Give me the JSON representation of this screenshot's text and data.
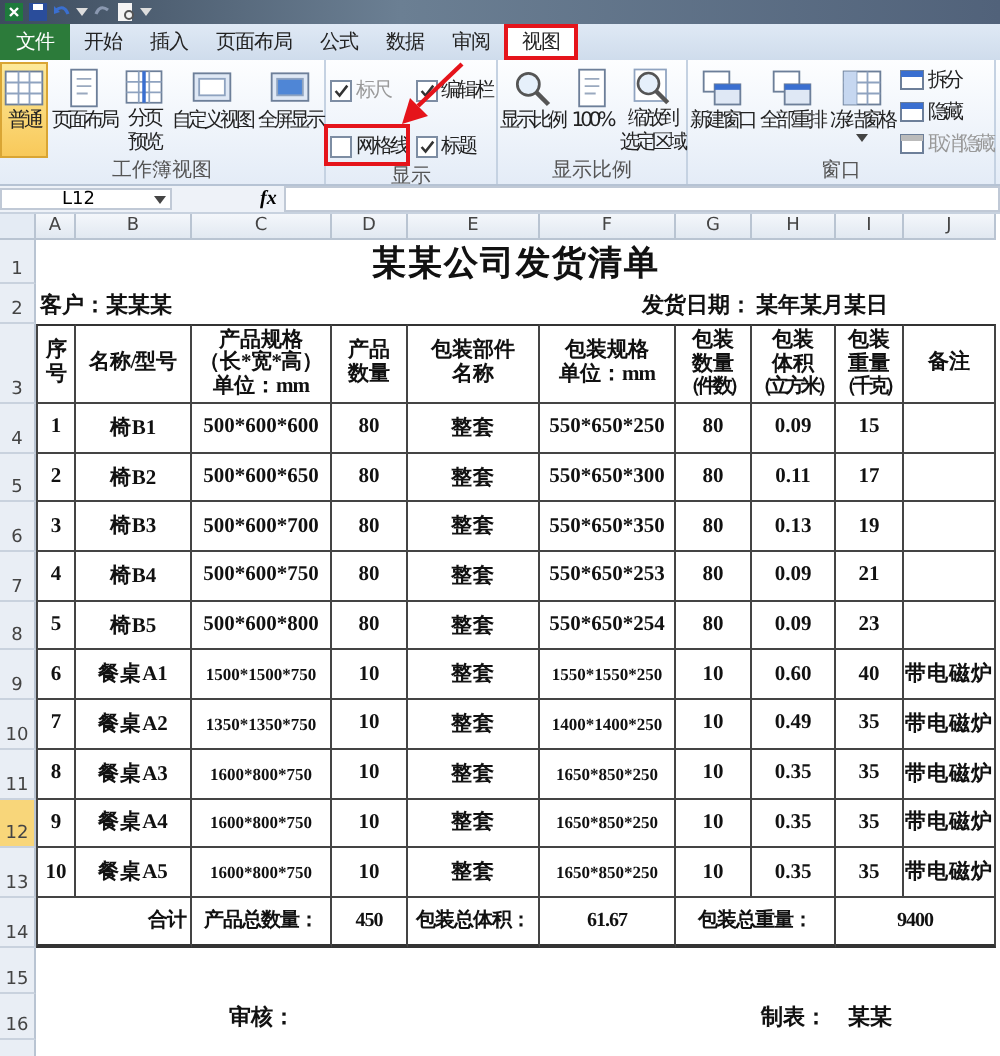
{
  "tabs": [
    {
      "label": "文件",
      "kind": "file",
      "selected": false,
      "highlighted": false
    },
    {
      "label": "开始",
      "kind": "tab",
      "selected": false,
      "highlighted": false
    },
    {
      "label": "插入",
      "kind": "tab",
      "selected": false,
      "highlighted": false
    },
    {
      "label": "页面布局",
      "kind": "tab",
      "selected": false,
      "highlighted": false
    },
    {
      "label": "公式",
      "kind": "tab",
      "selected": false,
      "highlighted": false
    },
    {
      "label": "数据",
      "kind": "tab",
      "selected": false,
      "highlighted": false
    },
    {
      "label": "审阅",
      "kind": "tab",
      "selected": false,
      "highlighted": false
    },
    {
      "label": "视图",
      "kind": "tab",
      "selected": true,
      "highlighted": true
    }
  ],
  "ribbon": {
    "groups": [
      {
        "label": "工作簿视图",
        "items": [
          {
            "kind": "large",
            "lines": [
              "普通"
            ],
            "selected": true,
            "dropdown": false
          },
          {
            "kind": "large",
            "lines": [
              "页面布局"
            ],
            "selected": false,
            "dropdown": false
          },
          {
            "kind": "large",
            "lines": [
              "分页",
              "预览"
            ],
            "selected": false,
            "dropdown": false
          },
          {
            "kind": "large",
            "lines": [
              "自定义视图"
            ],
            "selected": false,
            "dropdown": false
          },
          {
            "kind": "large",
            "lines": [
              "全屏显示"
            ],
            "selected": false,
            "dropdown": false
          }
        ]
      },
      {
        "label": "显示",
        "items": [
          {
            "kind": "check",
            "label": "标尺",
            "checked": true,
            "disabled": true
          },
          {
            "kind": "check",
            "label": "编辑栏",
            "checked": true,
            "disabled": false
          },
          {
            "kind": "check",
            "label": "网格线",
            "checked": false,
            "disabled": false
          },
          {
            "kind": "check",
            "label": "标题",
            "checked": true,
            "disabled": false
          }
        ]
      },
      {
        "label": "显示比例",
        "items": [
          {
            "kind": "large",
            "lines": [
              "显示比例"
            ],
            "selected": false,
            "dropdown": false
          },
          {
            "kind": "large",
            "lines": [
              "100%"
            ],
            "selected": false,
            "dropdown": false
          },
          {
            "kind": "large",
            "lines": [
              "缩放到",
              "选定区域"
            ],
            "selected": false,
            "dropdown": false
          }
        ]
      },
      {
        "label": "窗口",
        "items": [
          {
            "kind": "large",
            "lines": [
              "新建窗口"
            ],
            "selected": false,
            "dropdown": false
          },
          {
            "kind": "large",
            "lines": [
              "全部重排"
            ],
            "selected": false,
            "dropdown": false
          },
          {
            "kind": "large",
            "lines": [
              "冻结窗格"
            ],
            "selected": false,
            "dropdown": true
          },
          {
            "kind": "small",
            "label": "拆分",
            "disabled": false
          },
          {
            "kind": "small",
            "label": "隐藏",
            "disabled": false
          },
          {
            "kind": "small",
            "label": "取消隐藏",
            "disabled": true
          }
        ]
      }
    ]
  },
  "formula_bar": {
    "name_box": "L12",
    "function_label": "fx"
  },
  "sheet": {
    "columns": [
      {
        "label": "A",
        "selected": false
      },
      {
        "label": "B",
        "selected": false
      },
      {
        "label": "C",
        "selected": false
      },
      {
        "label": "D",
        "selected": false
      },
      {
        "label": "E",
        "selected": false
      },
      {
        "label": "F",
        "selected": false
      },
      {
        "label": "G",
        "selected": false
      },
      {
        "label": "H",
        "selected": false
      },
      {
        "label": "I",
        "selected": false
      },
      {
        "label": "J",
        "selected": false
      }
    ],
    "rows": [
      {
        "label": "1",
        "selected": false
      },
      {
        "label": "2",
        "selected": false
      },
      {
        "label": "3",
        "selected": false
      },
      {
        "label": "4",
        "selected": false
      },
      {
        "label": "5",
        "selected": false
      },
      {
        "label": "6",
        "selected": false
      },
      {
        "label": "7",
        "selected": false
      },
      {
        "label": "8",
        "selected": false
      },
      {
        "label": "9",
        "selected": false
      },
      {
        "label": "10",
        "selected": false
      },
      {
        "label": "11",
        "selected": false
      },
      {
        "label": "12",
        "selected": true
      },
      {
        "label": "13",
        "selected": false
      },
      {
        "label": "14",
        "selected": false
      },
      {
        "label": "15",
        "selected": false
      },
      {
        "label": "16",
        "selected": false
      }
    ],
    "title": "某某公司发货清单",
    "customer": "客户：某某某",
    "date_label": "发货日期：",
    "date": "某年某月某日",
    "header": [
      {
        "lines": [
          "序",
          "号"
        ]
      },
      {
        "lines": [
          "名称/型号"
        ]
      },
      {
        "lines": [
          "产品规格",
          "（长*宽*高）",
          "单位：mm"
        ]
      },
      {
        "lines": [
          "产品",
          "数量"
        ]
      },
      {
        "lines": [
          "包装部件",
          "名称"
        ]
      },
      {
        "lines": [
          "包装规格",
          "单位：mm"
        ]
      },
      {
        "lines": [
          "包装",
          "数量"
        ],
        "note": "（件数）"
      },
      {
        "lines": [
          "包装",
          "体积"
        ],
        "note": "（立方米）"
      },
      {
        "lines": [
          "包装",
          "重量"
        ],
        "note": "（千克）"
      },
      {
        "lines": [
          "备注"
        ]
      }
    ],
    "items": [
      [
        "1",
        "椅B1",
        "500*600*600",
        "80",
        "整套",
        "550*650*250",
        "80",
        "0.09",
        "15"
      ],
      [
        "2",
        "椅B2",
        "500*600*650",
        "80",
        "整套",
        "550*650*300",
        "80",
        "0.11",
        "17"
      ],
      [
        "3",
        "椅B3",
        "500*600*700",
        "80",
        "整套",
        "550*650*350",
        "80",
        "0.13",
        "19"
      ],
      [
        "4",
        "椅B4",
        "500*600*750",
        "80",
        "整套",
        "550*650*253",
        "80",
        "0.09",
        "21"
      ],
      [
        "5",
        "椅B5",
        "500*600*800",
        "80",
        "整套",
        "550*650*254",
        "80",
        "0.09",
        "23"
      ],
      [
        "6",
        "餐桌A1",
        "1500*1500*750",
        "10",
        "整套",
        "1550*1550*250",
        "10",
        "0.60",
        "40",
        "带电磁炉"
      ],
      [
        "7",
        "餐桌A2",
        "1350*1350*750",
        "10",
        "整套",
        "1400*1400*250",
        "10",
        "0.49",
        "35",
        "带电磁炉"
      ],
      [
        "8",
        "餐桌A3",
        "1600*800*750",
        "10",
        "整套",
        "1650*850*250",
        "10",
        "0.35",
        "35",
        "带电磁炉"
      ],
      [
        "9",
        "餐桌A4",
        "1600*800*750",
        "10",
        "整套",
        "1650*850*250",
        "10",
        "0.35",
        "35",
        "带电磁炉"
      ],
      [
        "10",
        "餐桌A5",
        "1600*800*750",
        "10",
        "整套",
        "1650*850*250",
        "10",
        "0.35",
        "35",
        "带电磁炉"
      ]
    ],
    "totals": [
      "合计",
      "产品总数量：",
      "450",
      "包装总体积：",
      "61.67",
      "包装总重量：",
      "9400"
    ],
    "signoff": {
      "reviewer_label": "审核：",
      "maker_label": "制表：",
      "maker": "某某"
    }
  }
}
